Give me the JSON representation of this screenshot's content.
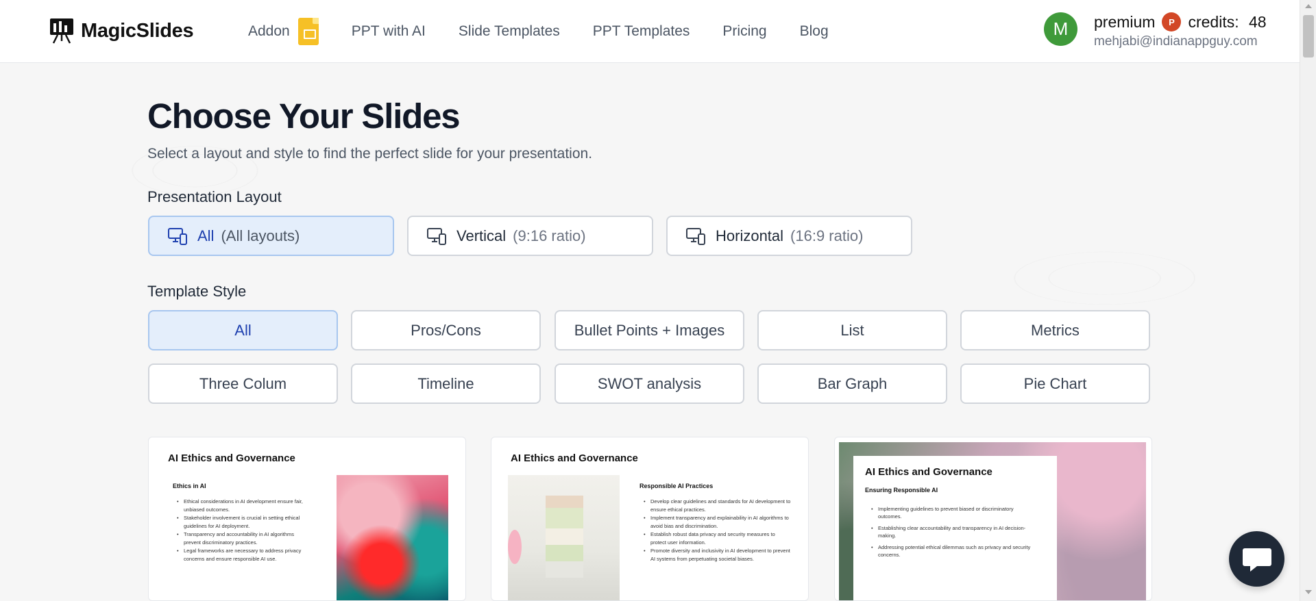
{
  "header": {
    "logo_text": "MagicSlides",
    "nav": [
      {
        "label": "Addon",
        "icon": "google-slides-icon"
      },
      {
        "label": "PPT with AI"
      },
      {
        "label": "Slide Templates"
      },
      {
        "label": "PPT Templates"
      },
      {
        "label": "Pricing"
      },
      {
        "label": "Blog"
      }
    ],
    "user": {
      "avatar_letter": "M",
      "plan": "premium",
      "credits_label": "credits:",
      "credits_value": "48",
      "email": "mehjabi@indianappguy.com"
    }
  },
  "main": {
    "title": "Choose Your Slides",
    "subtitle": "Select a layout and style to find the perfect slide for your presentation.",
    "layout_label": "Presentation Layout",
    "layouts": [
      {
        "label": "All",
        "sub": "(All layouts)",
        "active": true
      },
      {
        "label": "Vertical",
        "sub": "(9:16 ratio)",
        "active": false
      },
      {
        "label": "Horizontal",
        "sub": "(16:9 ratio)",
        "active": false
      }
    ],
    "style_label": "Template Style",
    "styles": [
      "All",
      "Pros/Cons",
      "Bullet Points + Images",
      "List",
      "Metrics",
      "Three Colum",
      "Timeline",
      "SWOT analysis",
      "Bar Graph",
      "Pie Chart"
    ],
    "active_style": "All"
  },
  "cards": [
    {
      "title": "AI Ethics and Governance",
      "subtitle": "Ethics in AI",
      "bullets": [
        "Ethical considerations in AI development ensure fair, unbiased outcomes.",
        "Stakeholder involvement is crucial in setting ethical guidelines for AI deployment.",
        "Transparency and accountability in AI algorithms prevent discriminatory practices.",
        "Legal frameworks are necessary to address privacy concerns and ensure responsible AI use."
      ]
    },
    {
      "title": "AI Ethics and Governance",
      "subtitle": "Responsible AI Practices",
      "bullets": [
        "Develop clear guidelines and standards for AI development to ensure ethical practices.",
        "Implement transparency and explainability in AI algorithms to avoid bias and discrimination.",
        "Establish robust data privacy and security measures to protect user information.",
        "Promote diversity and inclusivity in AI development to prevent AI systems from perpetuating societal biases."
      ]
    },
    {
      "title": "AI Ethics and Governance",
      "subtitle": "Ensuring Responsible AI",
      "bullets": [
        "Implementing guidelines to prevent biased or discriminatory outcomes.",
        "Establishing clear accountability and transparency in AI decision-making.",
        "Addressing potential ethical dilemmas such as privacy and security concerns."
      ]
    }
  ],
  "colors": {
    "accent": "#1e40af",
    "active_bg": "#e4eefb",
    "avatar": "#3f9a3a",
    "chat": "#1f2937"
  }
}
